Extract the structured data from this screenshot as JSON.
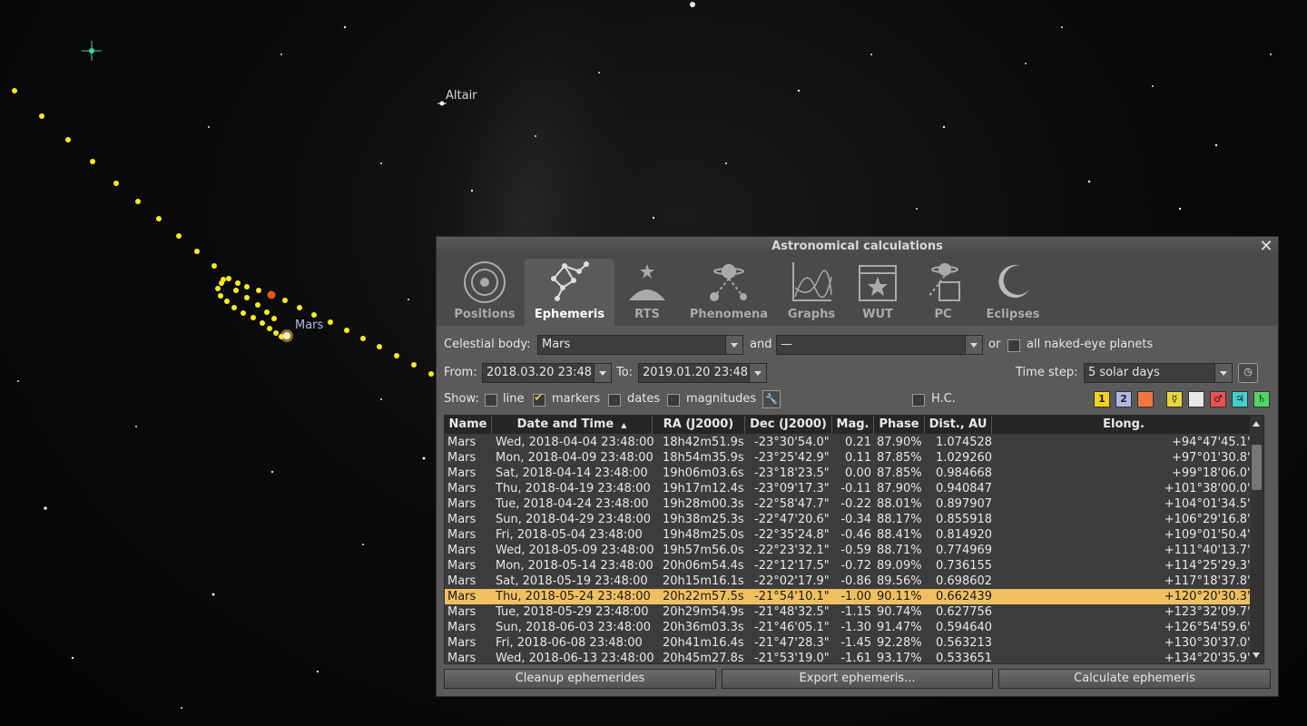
{
  "sky": {
    "labels": {
      "altair": "Altair",
      "mars": "Mars"
    },
    "colors": {
      "path": "#ffeb1e",
      "mars_marker": "#e8551c"
    }
  },
  "dialog": {
    "title": "Astronomical calculations",
    "close_icon": "close-icon",
    "tabs": [
      {
        "label": "Positions",
        "icon": "positions-icon",
        "active": false
      },
      {
        "label": "Ephemeris",
        "icon": "ephemeris-icon",
        "active": true
      },
      {
        "label": "RTS",
        "icon": "rts-icon",
        "active": false
      },
      {
        "label": "Phenomena",
        "icon": "phenomena-icon",
        "active": false
      },
      {
        "label": "Graphs",
        "icon": "graphs-icon",
        "active": false
      },
      {
        "label": "WUT",
        "icon": "wut-icon",
        "active": false
      },
      {
        "label": "PC",
        "icon": "pc-icon",
        "active": false
      },
      {
        "label": "Eclipses",
        "icon": "eclipses-icon",
        "active": false
      }
    ],
    "celestial_body_label": "Celestial body:",
    "celestial_body_value": "Mars",
    "and_label": "and",
    "second_body_value": "—",
    "or_label": "or",
    "all_planets_label": "all naked-eye planets",
    "from_label": "From:",
    "from_value": "2018.03.20 23:48",
    "to_label": "To:",
    "to_value": "2019.01.20 23:48",
    "time_step_label": "Time step:",
    "time_step_value": "5 solar days",
    "show_label": "Show:",
    "show_options": {
      "line": "line",
      "markers": "markers",
      "dates": "dates",
      "magnitudes": "magnitudes"
    },
    "show_checked": {
      "line": false,
      "markers": true,
      "dates": false,
      "magnitudes": false
    },
    "hc_label": "H.C.",
    "swatches": [
      {
        "text": "1",
        "color": "#f5d21e"
      },
      {
        "text": "2",
        "color": "#b0b8e8"
      },
      {
        "text": "",
        "color": "#f07840"
      },
      {
        "text": "☿",
        "color": "#e8d840"
      },
      {
        "text": "",
        "color": "#e8e8e8"
      },
      {
        "text": "♂",
        "color": "#f05050"
      },
      {
        "text": "♃",
        "color": "#40d0d0"
      },
      {
        "text": "♄",
        "color": "#50d860"
      }
    ],
    "table": {
      "headers": [
        "Name",
        "Date and Time",
        "RA (J2000)",
        "Dec (J2000)",
        "Mag.",
        "Phase",
        "Dist., AU",
        "Elong."
      ],
      "selected_row": 10,
      "rows": [
        [
          "Mars",
          "Wed, 2018-04-04 23:48:00",
          "18h42m51.9s",
          "-23°30'54.0\"",
          "0.21",
          "87.90%",
          "1.074528",
          "+94°47'45.1\""
        ],
        [
          "Mars",
          "Mon, 2018-04-09 23:48:00",
          "18h54m35.9s",
          "-23°25'42.9\"",
          "0.11",
          "87.85%",
          "1.029260",
          "+97°01'30.8\""
        ],
        [
          "Mars",
          "Sat, 2018-04-14 23:48:00",
          "19h06m03.6s",
          "-23°18'23.5\"",
          "0.00",
          "87.85%",
          "0.984668",
          "+99°18'06.0\""
        ],
        [
          "Mars",
          "Thu, 2018-04-19 23:48:00",
          "19h17m12.4s",
          "-23°09'17.3\"",
          "-0.11",
          "87.90%",
          "0.940847",
          "+101°38'00.0\""
        ],
        [
          "Mars",
          "Tue, 2018-04-24 23:48:00",
          "19h28m00.3s",
          "-22°58'47.7\"",
          "-0.22",
          "88.01%",
          "0.897907",
          "+104°01'34.5\""
        ],
        [
          "Mars",
          "Sun, 2018-04-29 23:48:00",
          "19h38m25.3s",
          "-22°47'20.6\"",
          "-0.34",
          "88.17%",
          "0.855918",
          "+106°29'16.8\""
        ],
        [
          "Mars",
          "Fri, 2018-05-04 23:48:00",
          "19h48m25.0s",
          "-22°35'24.8\"",
          "-0.46",
          "88.41%",
          "0.814920",
          "+109°01'50.4\""
        ],
        [
          "Mars",
          "Wed, 2018-05-09 23:48:00",
          "19h57m56.0s",
          "-22°23'32.1\"",
          "-0.59",
          "88.71%",
          "0.774969",
          "+111°40'13.7\""
        ],
        [
          "Mars",
          "Mon, 2018-05-14 23:48:00",
          "20h06m54.4s",
          "-22°12'17.5\"",
          "-0.72",
          "89.09%",
          "0.736155",
          "+114°25'29.3\""
        ],
        [
          "Mars",
          "Sat, 2018-05-19 23:48:00",
          "20h15m16.1s",
          "-22°02'17.9\"",
          "-0.86",
          "89.56%",
          "0.698602",
          "+117°18'37.8\""
        ],
        [
          "Mars",
          "Thu, 2018-05-24 23:48:00",
          "20h22m57.5s",
          "-21°54'10.1\"",
          "-1.00",
          "90.11%",
          "0.662439",
          "+120°20'30.3\""
        ],
        [
          "Mars",
          "Tue, 2018-05-29 23:48:00",
          "20h29m54.9s",
          "-21°48'32.5\"",
          "-1.15",
          "90.74%",
          "0.627756",
          "+123°32'09.7\""
        ],
        [
          "Mars",
          "Sun, 2018-06-03 23:48:00",
          "20h36m03.3s",
          "-21°46'05.1\"",
          "-1.30",
          "91.47%",
          "0.594640",
          "+126°54'59.6\""
        ],
        [
          "Mars",
          "Fri, 2018-06-08 23:48:00",
          "20h41m16.4s",
          "-21°47'28.3\"",
          "-1.45",
          "92.28%",
          "0.563213",
          "+130°30'37.0\""
        ],
        [
          "Mars",
          "Wed, 2018-06-13 23:48:00",
          "20h45m27.8s",
          "-21°53'19.0\"",
          "-1.61",
          "93.17%",
          "0.533651",
          "+134°20'35.9\""
        ]
      ]
    },
    "buttons": {
      "cleanup": "Cleanup ephemerides",
      "export": "Export ephemeris...",
      "calculate": "Calculate ephemeris"
    }
  }
}
